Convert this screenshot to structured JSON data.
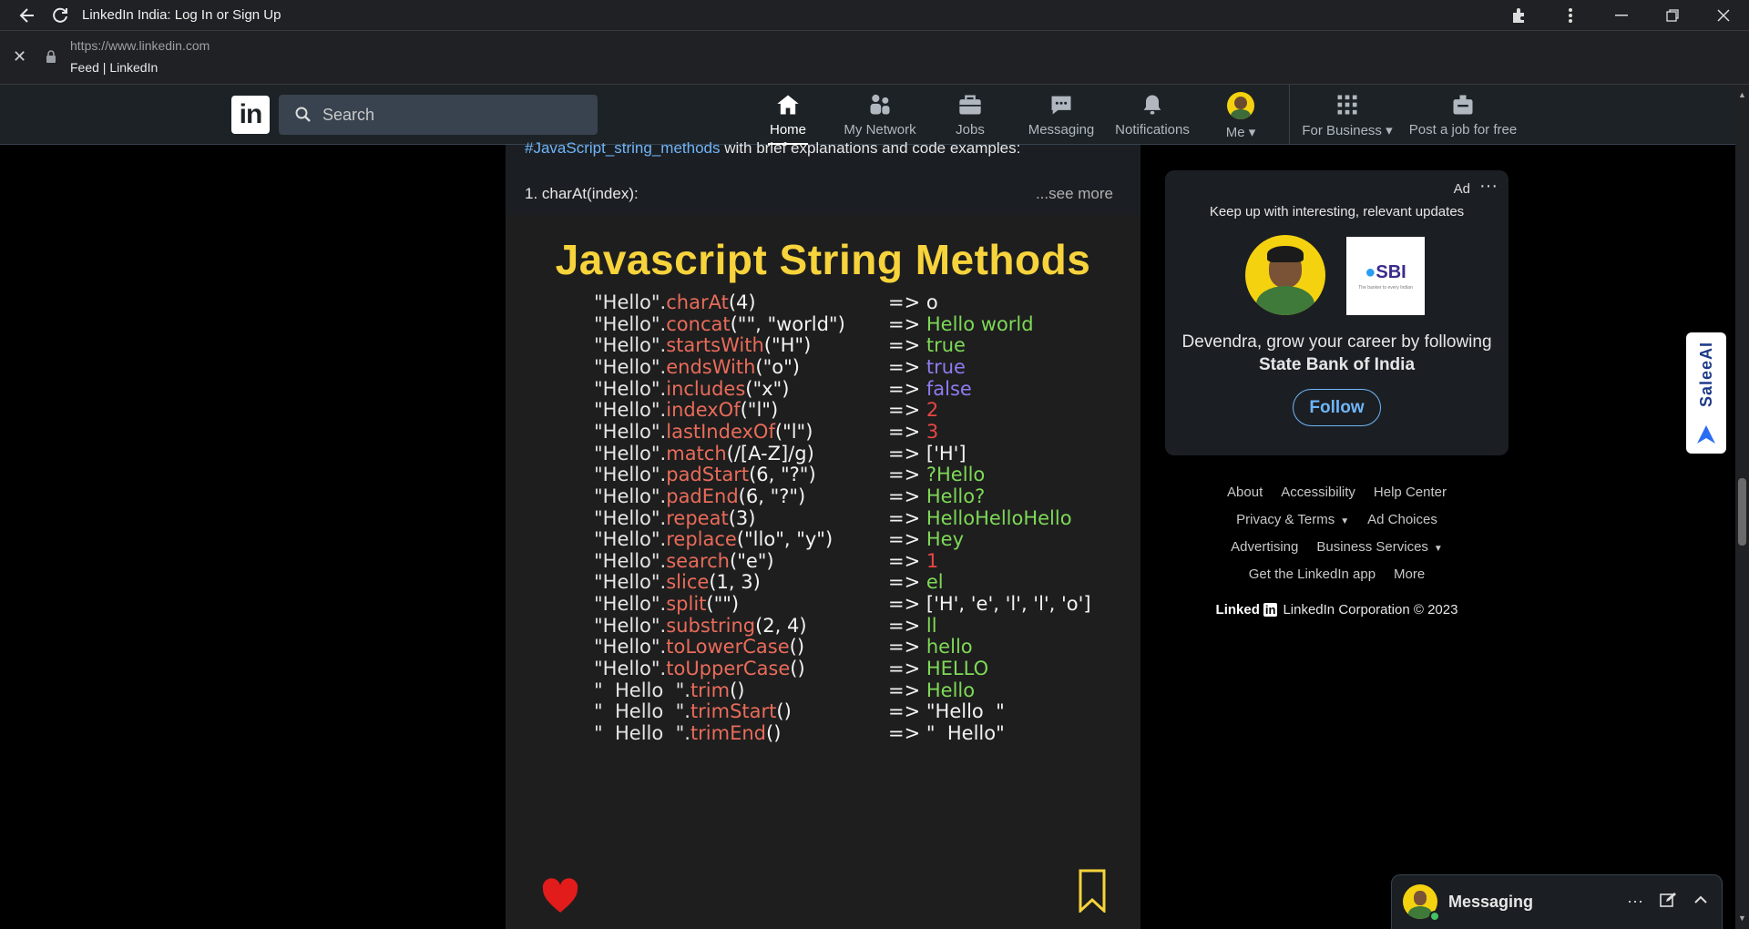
{
  "browser": {
    "tab_title": "LinkedIn India: Log In or Sign Up",
    "url": "https://www.linkedin.com",
    "page_subtitle": "Feed | LinkedIn"
  },
  "nav": {
    "logo_text": "in",
    "search_placeholder": "Search",
    "items": [
      {
        "label": "Home",
        "icon": "home-icon"
      },
      {
        "label": "My Network",
        "icon": "network-icon"
      },
      {
        "label": "Jobs",
        "icon": "briefcase-icon"
      },
      {
        "label": "Messaging",
        "icon": "chat-icon"
      },
      {
        "label": "Notifications",
        "icon": "bell-icon"
      },
      {
        "label": "Me",
        "icon": "avatar"
      },
      {
        "label": "For Business",
        "icon": "grid-icon"
      },
      {
        "label": "Post a job for free",
        "icon": "post-job-icon"
      }
    ]
  },
  "post": {
    "hashtag": "#JavaScript_string_methods",
    "text_after_hashtag": " with brief explanations and code examples:",
    "line2": "1. charAt(index):",
    "see_more": "...see more",
    "image": {
      "title": "Javascript  String Methods",
      "rows": [
        {
          "recv": "\"Hello\".",
          "method": "charAt",
          "args": "(4)",
          "result": "o",
          "result_color": "#f2f2f2"
        },
        {
          "recv": "\"Hello\".",
          "method": "concat",
          "args": "(\"\", \"world\")",
          "result": "Hello world",
          "result_color": "#7ed957"
        },
        {
          "recv": "\"Hello\".",
          "method": "startsWith",
          "args": "(\"H\")",
          "result": "true",
          "result_color": "#7ed957"
        },
        {
          "recv": "\"Hello\".",
          "method": "endsWith",
          "args": "(\"o\")",
          "result": "true",
          "result_color": "#8f7bf0"
        },
        {
          "recv": "\"Hello\".",
          "method": "includes",
          "args": "(\"x\")",
          "result": "false",
          "result_color": "#8f7bf0"
        },
        {
          "recv": "\"Hello\".",
          "method": "indexOf",
          "args": "(\"l\")",
          "result": "2",
          "result_color": "#e84545"
        },
        {
          "recv": "\"Hello\".",
          "method": "lastIndexOf",
          "args": "(\"l\")",
          "result": "3",
          "result_color": "#e84545"
        },
        {
          "recv": "\"Hello\".",
          "method": "match",
          "args": "(/[A-Z]/g)",
          "result": "['H']",
          "result_color": "#f2f2f2"
        },
        {
          "recv": "\"Hello\".",
          "method": "padStart",
          "args": "(6, \"?\")",
          "result": "?Hello",
          "result_color": "#7ed957"
        },
        {
          "recv": "\"Hello\".",
          "method": "padEnd",
          "args": "(6, \"?\")",
          "result": "Hello?",
          "result_color": "#7ed957"
        },
        {
          "recv": "\"Hello\".",
          "method": "repeat",
          "args": "(3)",
          "result": "HelloHelloHello",
          "result_color": "#7ed957"
        },
        {
          "recv": "\"Hello\".",
          "method": "replace",
          "args": "(\"llo\", \"y\")",
          "result": "Hey",
          "result_color": "#7ed957"
        },
        {
          "recv": "\"Hello\".",
          "method": "search",
          "args": "(\"e\")",
          "result": "1",
          "result_color": "#e84545"
        },
        {
          "recv": "\"Hello\".",
          "method": "slice",
          "args": "(1, 3)",
          "result": "el",
          "result_color": "#7ed957"
        },
        {
          "recv": "\"Hello\".",
          "method": "split",
          "args": "(\"\")",
          "result": "['H', 'e', 'l', 'l', 'o']",
          "result_color": "#f2f2f2"
        },
        {
          "recv": "\"Hello\".",
          "method": "substring",
          "args": "(2, 4)",
          "result": "ll",
          "result_color": "#7ed957"
        },
        {
          "recv": "\"Hello\".",
          "method": "toLowerCase",
          "args": "()",
          "result": "hello",
          "result_color": "#7ed957"
        },
        {
          "recv": "\"Hello\".",
          "method": "toUpperCase",
          "args": "()",
          "result": "HELLO",
          "result_color": "#7ed957"
        },
        {
          "recv": "\"  Hello  \".",
          "method": "trim",
          "args": "()",
          "result": "Hello",
          "result_color": "#7ed957"
        },
        {
          "recv": "\"  Hello  \".",
          "method": "trimStart",
          "args": "()",
          "result": "\"Hello  \"",
          "result_color": "#f2f2f2"
        },
        {
          "recv": "\"  Hello  \".",
          "method": "trimEnd",
          "args": "()",
          "result": "\"  Hello\"",
          "result_color": "#f2f2f2"
        }
      ]
    }
  },
  "ad": {
    "label": "Ad",
    "tagline": "Keep up with interesting, relevant updates",
    "logo_text": "SBI",
    "logo_sub": "The banker to every Indian",
    "message_line1": "Devendra, grow your career by following",
    "message_company": "State Bank of India",
    "follow_label": "Follow"
  },
  "footer": {
    "rows": [
      [
        "About",
        "Accessibility",
        "Help Center"
      ],
      [
        "Privacy & Terms",
        "Ad Choices"
      ],
      [
        "Advertising",
        "Business Services"
      ],
      [
        "Get the LinkedIn app",
        "More"
      ]
    ],
    "brand": "Linked",
    "brand_box": "in",
    "copyright": "LinkedIn Corporation © 2023"
  },
  "salee": {
    "label": "SaleeAI"
  },
  "messaging": {
    "title": "Messaging"
  },
  "colors": {
    "accent": "#70b5f9",
    "nav_bg": "#1d2226",
    "card_bg": "#1b1f23",
    "title_yellow": "#f7d33c",
    "method_red": "#e96b5a"
  }
}
